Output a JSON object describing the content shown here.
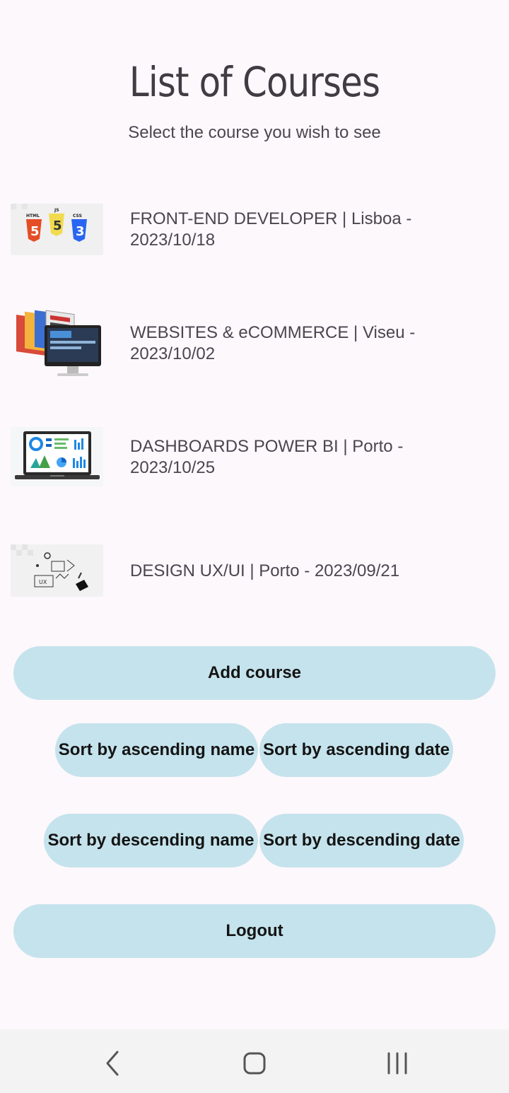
{
  "header": {
    "title": "List of Courses",
    "subtitle": "Select the course you wish to see"
  },
  "courses": [
    {
      "label": "FRONT-END DEVELOPER | Lisboa - 2023/10/18",
      "icon": "html-js-css-logos"
    },
    {
      "label": "WEBSITES & eCOMMERCE | Viseu - 2023/10/02",
      "icon": "website-monitor-image"
    },
    {
      "label": "DASHBOARDS POWER BI | Porto - 2023/10/25",
      "icon": "laptop-dashboard-image"
    },
    {
      "label": "DESIGN UX/UI | Porto - 2023/09/21",
      "icon": "ux-sketch-image"
    }
  ],
  "buttons": {
    "add_course": "Add course",
    "sort_asc_name": "Sort by ascending name",
    "sort_asc_date": "Sort by ascending date",
    "sort_desc_name": "Sort by descending name",
    "sort_desc_date": "Sort by descending date",
    "logout": "Logout"
  },
  "navbar": {
    "back": "back-icon",
    "home": "home-icon",
    "recents": "recents-icon"
  },
  "colors": {
    "background": "#fdf8fc",
    "button": "#c5e3ec",
    "navbar": "#f3f3f3"
  }
}
